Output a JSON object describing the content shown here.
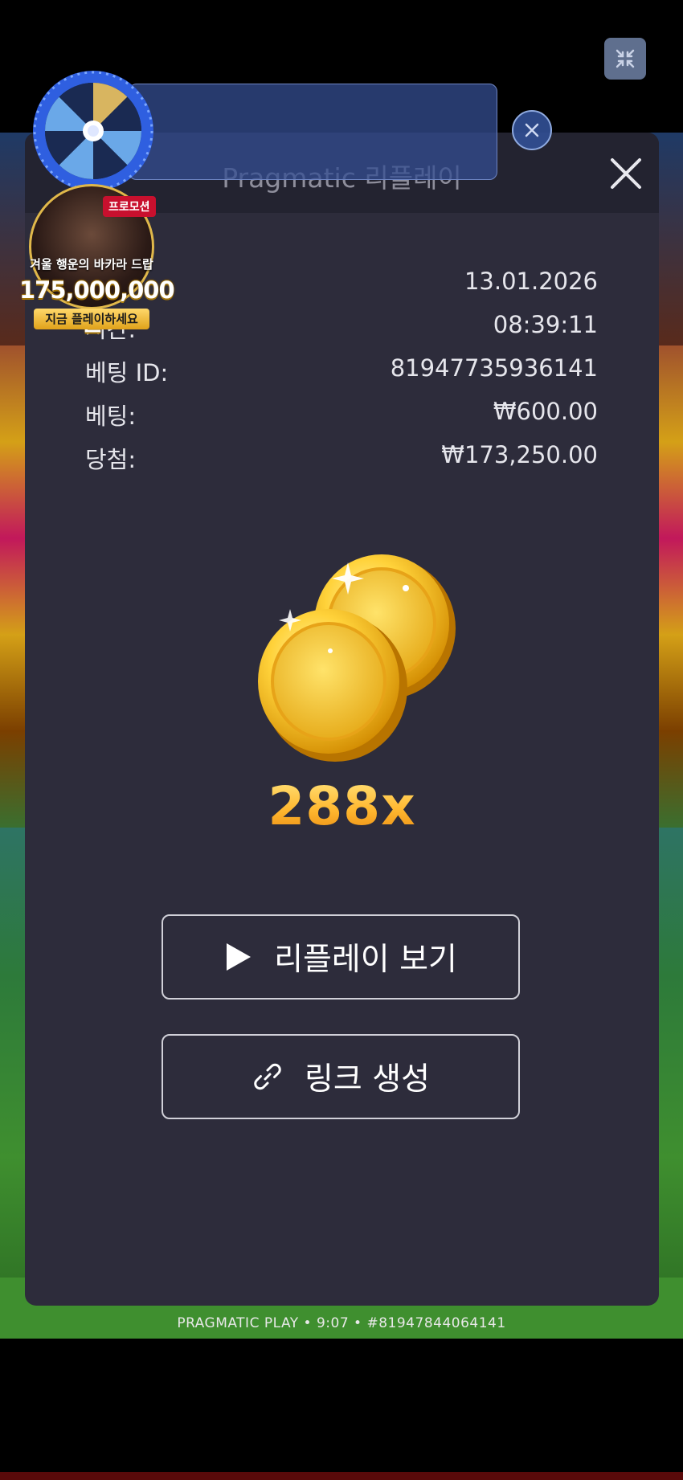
{
  "game": {
    "footer_caption": "PRAGMATIC PLAY • 9:07 • #81947844064141"
  },
  "replay_panel": {
    "title": "Pragmatic 리플레이",
    "rows": [
      {
        "label": "",
        "value": "13.01.2026"
      },
      {
        "label": "시간:",
        "value": "08:39:11"
      },
      {
        "label": "베팅 ID:",
        "value": "81947735936141"
      },
      {
        "label": "베팅:",
        "value": "₩600.00"
      },
      {
        "label": "당첨:",
        "value": "₩173,250.00"
      }
    ],
    "multiplier": "288x",
    "watch_replay_label": "리플레이 보기",
    "create_link_label": "링크 생성"
  },
  "promo": {
    "tag": "프로모션",
    "headline": "겨울 행운의 바카라 드랍",
    "amount": "175,000,000원",
    "cta": "지금 플레이하세요"
  },
  "icons": {
    "minimize": "minimize-icon",
    "close": "close-icon",
    "play": "play-icon",
    "link": "link-icon",
    "wheel": "prize-wheel-icon",
    "coins": "gold-coins-icon"
  },
  "colors": {
    "panel_bg": "#2d2c3b",
    "header_bg": "#232330",
    "multiplier_gold": "#ffb830"
  }
}
